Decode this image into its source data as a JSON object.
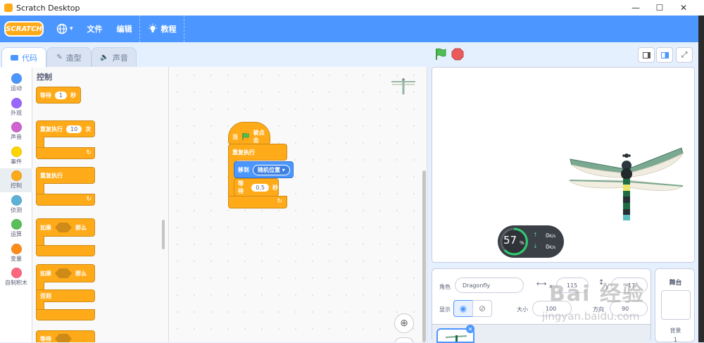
{
  "window": {
    "title": "Scratch Desktop",
    "controls": [
      "—",
      "☐",
      "✕"
    ]
  },
  "menubar": {
    "logo": "SCRATCH",
    "globe_caret": "▾",
    "file": "文件",
    "edit": "编辑",
    "tutorials": "教程"
  },
  "tabs": {
    "code": "代码",
    "costumes": "造型",
    "sounds": "声音"
  },
  "categories": [
    {
      "label": "运动",
      "color": "#4c97ff"
    },
    {
      "label": "外观",
      "color": "#9966ff"
    },
    {
      "label": "声音",
      "color": "#cf63cf"
    },
    {
      "label": "事件",
      "color": "#ffd500"
    },
    {
      "label": "控制",
      "color": "#ffab19"
    },
    {
      "label": "侦测",
      "color": "#5cb1d6"
    },
    {
      "label": "运算",
      "color": "#59c059"
    },
    {
      "label": "变量",
      "color": "#ff8c1a"
    },
    {
      "label": "自制积木",
      "color": "#ff6680"
    }
  ],
  "palette": {
    "title": "控制",
    "wait": {
      "label": "等待",
      "value": "1",
      "unit": "秒"
    },
    "repeat": {
      "label": "重复执行",
      "value": "10",
      "unit": "次"
    },
    "forever": {
      "label": "重复执行"
    },
    "if_then": {
      "if": "如果",
      "then": "那么"
    },
    "if_else": {
      "if": "如果",
      "then": "那么",
      "else": "否则"
    },
    "wait_until": {
      "label": "等待"
    }
  },
  "script": {
    "hat": {
      "when": "当",
      "clicked": "被点击"
    },
    "forever": "重复执行",
    "goto": {
      "label": "移到",
      "target": "随机位置",
      "caret": "▾"
    },
    "wait": {
      "label": "等待",
      "value": "0.5",
      "unit": "秒"
    }
  },
  "net": {
    "percent": "57",
    "percent_sign": "%",
    "up": "0",
    "down": "0",
    "unit": "K/s"
  },
  "sprite": {
    "sprite_label": "角色",
    "name": "Dragonfly",
    "x_label": "x",
    "x": "115",
    "y_label": "y",
    "y": "-17",
    "show_label": "显示",
    "size_label": "大小",
    "size": "100",
    "direction_label": "方向",
    "direction": "90"
  },
  "stage_panel": {
    "title": "舞台",
    "backdrops_label": "背景",
    "backdrops_count": "1"
  },
  "watermark": {
    "text": "Bai 经验",
    "url": "jingyan.baidu.com"
  },
  "colors": {
    "menubar": "#4c97ff",
    "control": "#ffab19",
    "motion": "#4c97ff"
  }
}
